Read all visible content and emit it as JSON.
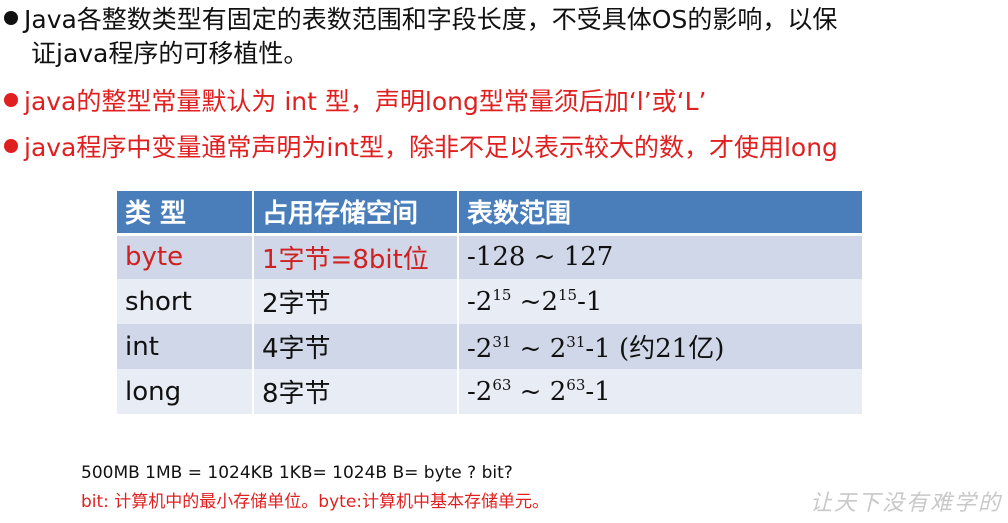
{
  "bullets": [
    {
      "line1": "Java各整数类型有固定的表数范围和字段长度，不受具体OS的影响，以保",
      "line2": "证java程序的可移植性。"
    },
    {
      "text": "java的整型常量默认为 int 型，声明long型常量须后加‘l’或‘L’"
    },
    {
      "text": "java程序中变量通常声明为int型，除非不足以表示较大的数，才使用long"
    }
  ],
  "table": {
    "headers": [
      "类  型",
      "占用存储空间",
      "表数范围"
    ],
    "rows": [
      {
        "type": "byte",
        "size": "1字节=8bit位",
        "range": "-128 ~ 127"
      },
      {
        "type": "short",
        "size": "2字节",
        "range_base1": "-2",
        "range_exp1": "15",
        "range_mid": " ~2",
        "range_exp2": "15",
        "range_tail": "-1"
      },
      {
        "type": "int",
        "size": "4字节",
        "range_base1": "-2",
        "range_exp1": "31",
        "range_mid": " ~ 2",
        "range_exp2": "31",
        "range_tail": "-1 (约21亿)"
      },
      {
        "type": "long",
        "size": "8字节",
        "range_base1": "-2",
        "range_exp1": "63",
        "range_mid": " ~ 2",
        "range_exp2": "63",
        "range_tail": "-1"
      }
    ]
  },
  "notes": {
    "line1": "500MB   1MB = 1024KB   1KB= 1024B   B= byte ? bit?",
    "line2": "bit: 计算机中的最小存储单位。byte:计算机中基本存储单元。"
  },
  "watermark": "让天下没有难学的",
  "colors": {
    "accent_red": "#e02020",
    "header_blue": "#4a7ebb",
    "row_dark": "#cfd7e8",
    "row_light": "#e8ecf5"
  }
}
